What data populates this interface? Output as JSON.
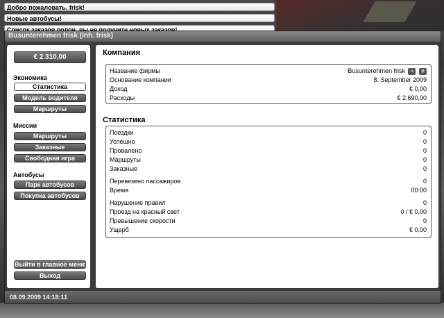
{
  "notifications": [
    "Добро пожаловать, frisk!",
    "Новые автобусы!",
    "Список заказов полон, вы не получите новых заказов!"
  ],
  "window": {
    "title": "Busunterehmen frisk (Inh. frisk)"
  },
  "sidebar": {
    "money": "€ 2.310,00",
    "economy": {
      "title": "Экономика",
      "items": [
        "Статистика",
        "Модель водителя",
        "Маршруты"
      ]
    },
    "missions": {
      "title": "Миссии",
      "items": [
        "Маршруты",
        "Заказные",
        "Свободная игра"
      ]
    },
    "buses": {
      "title": "Автобусы",
      "items": [
        "Парк автобусов",
        "Покупка автобусов"
      ]
    },
    "bottom": {
      "main_menu": "Выйти в главное меню",
      "exit": "Выход"
    }
  },
  "company": {
    "heading": "Компания",
    "rows": [
      {
        "label": "Название фирмы",
        "value": "Busunterehmen frisk"
      },
      {
        "label": "Основание компании",
        "value": "8. September 2009"
      },
      {
        "label": "Доход",
        "value": "€ 0,00"
      },
      {
        "label": "Расходы",
        "value": "€ 2.690,00"
      }
    ],
    "name_buttons": [
      ">",
      "#"
    ]
  },
  "stats": {
    "heading": "Статистика",
    "rows": [
      {
        "label": "Поездки",
        "value": "0"
      },
      {
        "label": "Успешно",
        "value": "0"
      },
      {
        "label": "Провалено",
        "value": "0"
      },
      {
        "label": "Маршруты",
        "value": "0"
      },
      {
        "label": "Заказные",
        "value": "0"
      },
      {
        "label": "Перевезено пассажиров",
        "value": "0"
      },
      {
        "label": "Время",
        "value": "00:00"
      },
      {
        "label": "Нарушение правил",
        "value": "0"
      },
      {
        "label": "Проезд на красный свет",
        "value": "0 / € 0,00"
      },
      {
        "label": "Превышение скорости",
        "value": "0"
      },
      {
        "label": "Ущерб",
        "value": "€ 0,00"
      }
    ]
  },
  "status_bar": "08.09.2009 14:18:11"
}
